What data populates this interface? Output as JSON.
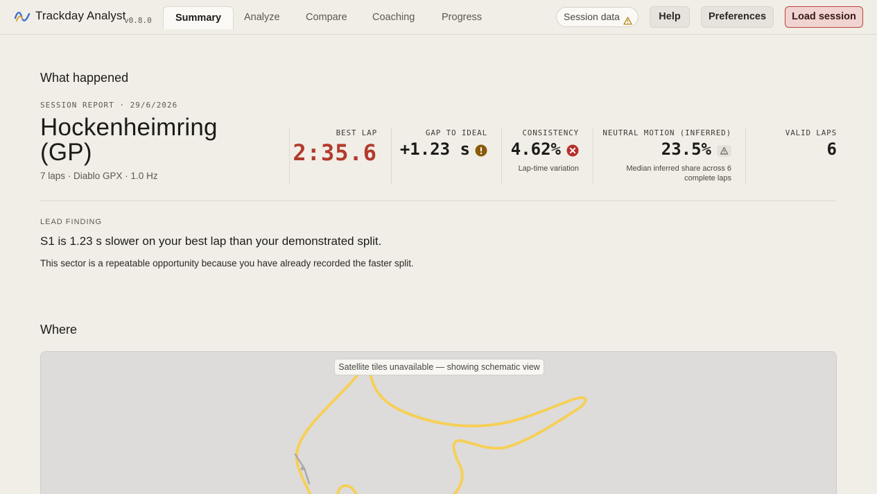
{
  "app": {
    "name": "Trackday Analyst",
    "version": "v0.8.0"
  },
  "tabs": [
    {
      "label": "Summary",
      "active": true
    },
    {
      "label": "Analyze",
      "active": false
    },
    {
      "label": "Compare",
      "active": false
    },
    {
      "label": "Coaching",
      "active": false
    },
    {
      "label": "Progress",
      "active": false
    }
  ],
  "header_actions": {
    "session_data_label": "Session data",
    "session_data_icon": "warning-icon",
    "help_label": "Help",
    "preferences_label": "Preferences",
    "load_session_label": "Load session"
  },
  "what_happened": {
    "heading": "What happened",
    "report_label": "SESSION REPORT · 29/6/2026",
    "track_name": "Hockenheimring (GP)",
    "subtitle": "7 laps · Diablo GPX · 1.0 Hz"
  },
  "metrics": [
    {
      "label": "BEST LAP",
      "value": "2:35.6",
      "note": "",
      "icon": "",
      "color": "#b23b2c"
    },
    {
      "label": "GAP TO IDEAL",
      "value": "+1.23 s",
      "note": "",
      "icon": "exclamation-circle-icon",
      "color": "#8a5a0b"
    },
    {
      "label": "CONSISTENCY",
      "value": "4.62%",
      "note": "Lap-time variation",
      "icon": "x-circle-icon",
      "color": "#b7302a"
    },
    {
      "label": "NEUTRAL MOTION (INFERRED)",
      "value": "23.5%",
      "note": "Median inferred share across 6 complete laps",
      "icon": "warning-icon",
      "color": "#6b6862"
    },
    {
      "label": "VALID LAPS",
      "value": "6",
      "note": "",
      "icon": "",
      "color": ""
    }
  ],
  "lead_finding": {
    "label": "LEAD FINDING",
    "headline": "S1 is 1.23 s slower on your best lap than your demonstrated split.",
    "body": "This sector is a repeatable opportunity because you have already recorded the faster split."
  },
  "where": {
    "heading": "Where",
    "map_notice": "Satellite tiles unavailable — showing schematic view",
    "track_color": "#f6cf57"
  }
}
